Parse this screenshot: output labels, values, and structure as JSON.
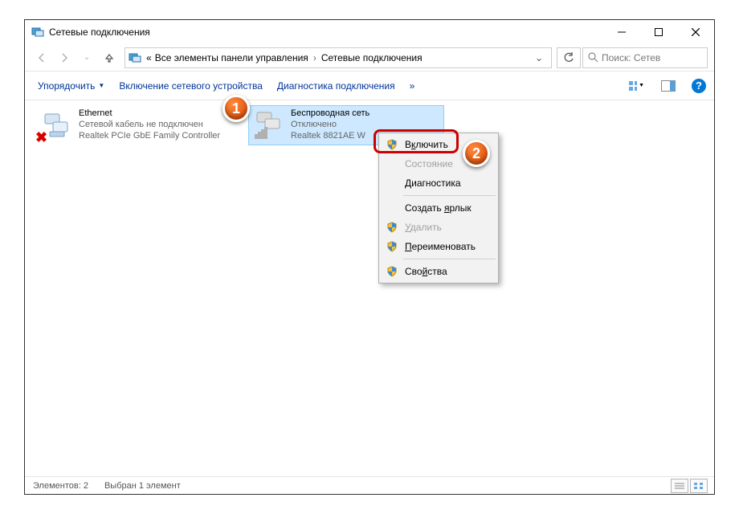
{
  "window": {
    "title": "Сетевые подключения"
  },
  "breadcrumb": {
    "prefix": "«",
    "item1": "Все элементы панели управления",
    "item2": "Сетевые подключения"
  },
  "search": {
    "placeholder": "Поиск: Сетев"
  },
  "cmdbar": {
    "organize": "Упорядочить",
    "enable": "Включение сетевого устройства",
    "diagnose": "Диагностика подключения"
  },
  "adapters": {
    "ethernet": {
      "name": "Ethernet",
      "status": "Сетевой кабель не подключен",
      "device": "Realtek PCIe GbE Family Controller"
    },
    "wifi": {
      "name": "Беспроводная сеть",
      "status": "Отключено",
      "device": "Realtek 8821AE W"
    }
  },
  "context_menu": {
    "enable": "Включить",
    "status": "Состояние",
    "diagnostics": "Диагностика",
    "shortcut": "Создать ярлык",
    "delete": "Удалить",
    "rename": "Переименовать",
    "properties": "Свойства"
  },
  "statusbar": {
    "count": "Элементов: 2",
    "selected": "Выбран 1 элемент"
  },
  "callouts": {
    "c1": "1",
    "c2": "2"
  }
}
